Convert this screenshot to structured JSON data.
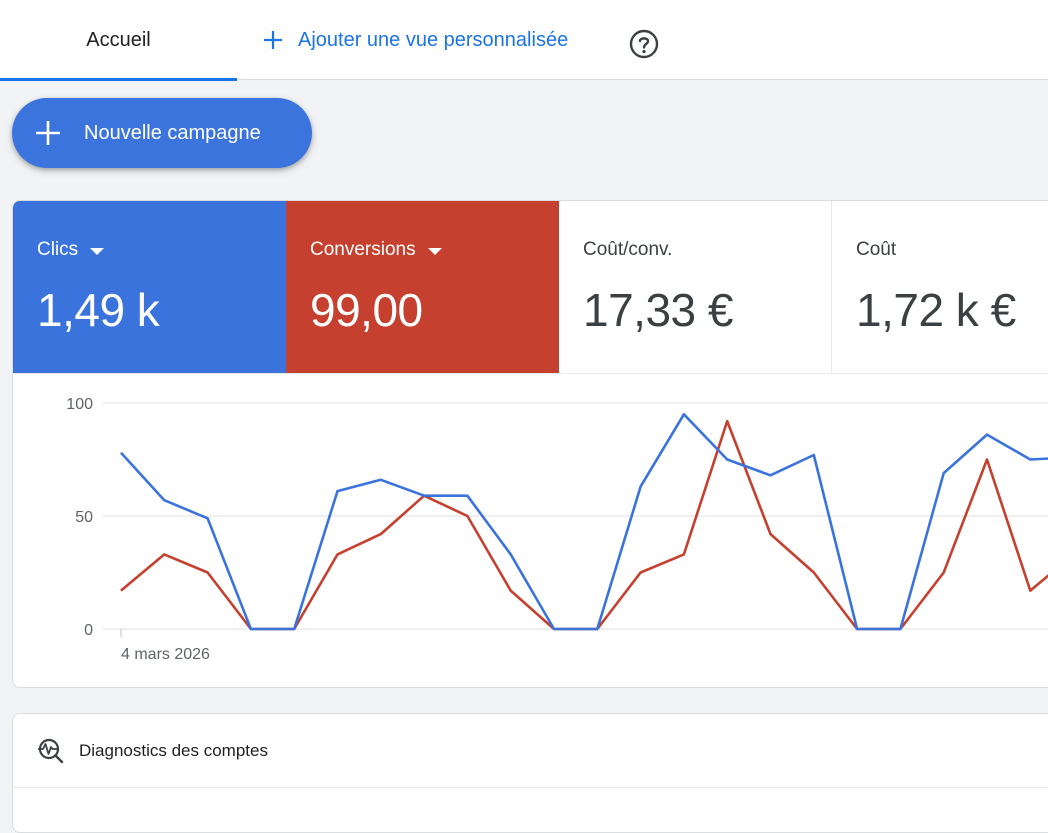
{
  "tabs": {
    "home_label": "Accueil",
    "add_view_label": "Ajouter une vue personnalisée"
  },
  "actions": {
    "new_campaign_label": "Nouvelle campagne"
  },
  "metrics": [
    {
      "label": "Clics",
      "value": "1,49 k",
      "has_dropdown": true,
      "color": "#3b73dd"
    },
    {
      "label": "Conversions",
      "value": "99,00",
      "has_dropdown": true,
      "color": "#c5402f"
    },
    {
      "label": "Coût/conv.",
      "value": "17,33 €",
      "has_dropdown": false
    },
    {
      "label": "Coût",
      "value": "1,72 k €",
      "has_dropdown": false
    }
  ],
  "icons": {
    "plus": "plus-icon",
    "help": "help-circle-icon",
    "dropdown": "caret-down-icon",
    "diagnostics": "diagnostics-icon"
  },
  "diagnostics": {
    "title": "Diagnostics des comptes"
  },
  "chart_data": {
    "type": "line",
    "title": "",
    "xlabel": "",
    "ylabel": "",
    "x_first_label": "4 mars 2026",
    "y_ticks": [
      "100",
      "50",
      "0"
    ],
    "ylim": [
      0,
      100
    ],
    "grid": true,
    "series": [
      {
        "name": "Clics",
        "color": "#3b73dd",
        "values": [
          78,
          57,
          49,
          0,
          0,
          61,
          66,
          59,
          59,
          33,
          0,
          0,
          63,
          95,
          75,
          68,
          77,
          0,
          0,
          69,
          86,
          75,
          76
        ]
      },
      {
        "name": "Conversions",
        "color": "#c5402f",
        "values": [
          17,
          33,
          25,
          0,
          0,
          33,
          42,
          59,
          50,
          17,
          0,
          0,
          25,
          33,
          92,
          42,
          25,
          0,
          0,
          25,
          75,
          17,
          33
        ]
      }
    ]
  }
}
